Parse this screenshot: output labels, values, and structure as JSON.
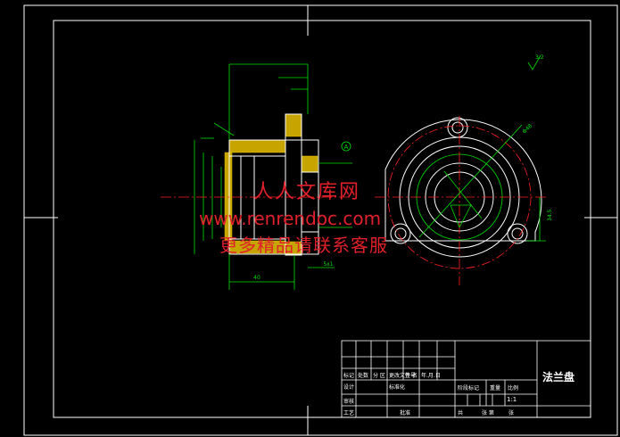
{
  "drawing": {
    "title_block": {
      "part_name": "法兰盘",
      "scale": "1:1",
      "header_cells": [
        "标记",
        "处数",
        "分 区",
        "更改文件号",
        "签 名",
        "年.月.日"
      ],
      "row_labels": [
        "设计",
        "审核",
        "工艺"
      ],
      "standardization": "标准化",
      "approve": "批准",
      "stage_labels": [
        "阶段标记",
        "重量",
        "比例"
      ],
      "sheet_info": [
        "共",
        "张 第",
        "张"
      ]
    },
    "watermark": {
      "line1": "人人文库网",
      "line2": "www.renrendoc.com",
      "line3": "更多精品请联系客服"
    },
    "annotations": {
      "section_marker": "A",
      "roughness_top": "3.2",
      "dim_bottom_left": "40",
      "dim_bottom_mid": "5x1",
      "dim_right_height": "34.5",
      "dim_phi": "Φ48"
    },
    "colors": {
      "frame": "#ffffff",
      "dimension": "#00ff00",
      "centerline": "#ff2020",
      "hatch": "#d4b000",
      "outline": "#ffffff",
      "annotation": "#00ffff"
    }
  }
}
